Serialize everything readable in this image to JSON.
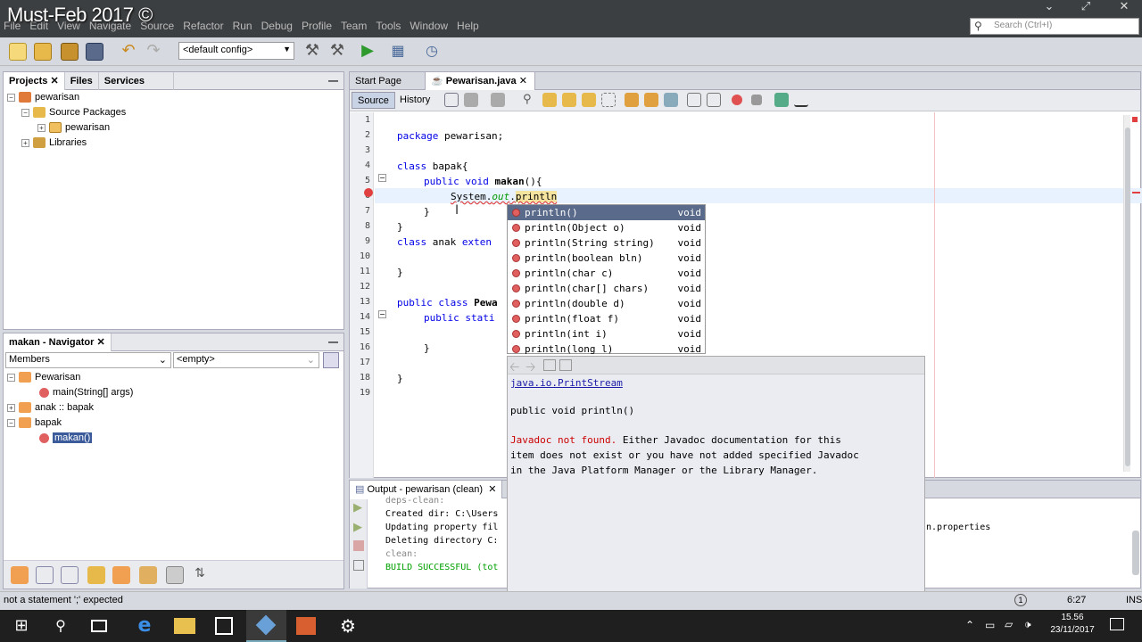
{
  "window": {
    "watermark": "Must-Feb 2017 ©"
  },
  "menu": [
    "File",
    "Edit",
    "View",
    "Navigate",
    "Source",
    "Refactor",
    "Run",
    "Debug",
    "Profile",
    "Team",
    "Tools",
    "Window",
    "Help"
  ],
  "search": {
    "placeholder": "Search (Ctrl+I)"
  },
  "toolbar": {
    "config": "<default config>"
  },
  "projects_panel": {
    "tabs": [
      "Projects",
      "Files",
      "Services"
    ],
    "tree": [
      {
        "label": "pewarisan"
      },
      {
        "label": "Source Packages"
      },
      {
        "label": "pewarisan"
      },
      {
        "label": "Libraries"
      }
    ]
  },
  "navigator": {
    "title": "makan - Navigator",
    "filter": "Members",
    "scope": "<empty>",
    "tree": [
      {
        "label": "Pewarisan"
      },
      {
        "label": "main(String[] args)"
      },
      {
        "label": "anak :: bapak"
      },
      {
        "label": "bapak"
      },
      {
        "label": "makan()"
      }
    ]
  },
  "editor": {
    "tabs": [
      "Start Page",
      "Pewarisan.java"
    ],
    "modes": [
      "Source",
      "History"
    ],
    "line_numbers": [
      "1",
      "2",
      "3",
      "4",
      "5",
      "6",
      "7",
      "8",
      "9",
      "10",
      "11",
      "12",
      "13",
      "14",
      "15",
      "16",
      "17",
      "18",
      "19"
    ],
    "lines": {
      "l2a": "package",
      "l2b": " pewarisan;",
      "l4a": "class",
      "l4b": " bapak{",
      "l5a": "public",
      "l5b": " void ",
      "l5c": "makan",
      "l5d": "(){",
      "l6a": "System.",
      "l6b": "out",
      "l6c": ".",
      "l6d": "println",
      "l7": "}",
      "l8": "}",
      "l9a": "class",
      "l9b": " anak ",
      "l9c": "exten",
      "l11": "}",
      "l13a": "public class",
      "l13b": " Pewa",
      "l14a": "public",
      "l14b": " stati",
      "l16": "}",
      "l18": "}"
    }
  },
  "completion": {
    "items": [
      {
        "name": "println()",
        "ret": "void"
      },
      {
        "name": "println(Object o)",
        "ret": "void"
      },
      {
        "name": "println(String string)",
        "ret": "void"
      },
      {
        "name": "println(boolean bln)",
        "ret": "void"
      },
      {
        "name": "println(char c)",
        "ret": "void"
      },
      {
        "name": "println(char[] chars)",
        "ret": "void"
      },
      {
        "name": "println(double d)",
        "ret": "void"
      },
      {
        "name": "println(float f)",
        "ret": "void"
      },
      {
        "name": "println(int i)",
        "ret": "void"
      },
      {
        "name": "println(long l)",
        "ret": "void"
      }
    ],
    "doc": {
      "link": "java.io.PrintStream",
      "signature": "public void println()",
      "msg_red": "Javadoc not found.",
      "msg_rest": " Either Javadoc documentation for this\nitem does not exist or you have not added specified Javadoc\nin the Java Platform Manager or the Library Manager."
    }
  },
  "output": {
    "title": "Output - pewarisan (clean)",
    "lines": [
      "deps-clean:",
      "Created dir: C:\\Users",
      "Updating property fil",
      "Deleting directory C:",
      "clean:",
      "BUILD SUCCESSFUL (tot"
    ],
    "right_text": "n.properties"
  },
  "status": {
    "message": "not a statement  ';' expected",
    "position": "6:27",
    "mode": "INS"
  },
  "taskbar": {
    "time": "15.56",
    "date": "23/11/2017"
  }
}
